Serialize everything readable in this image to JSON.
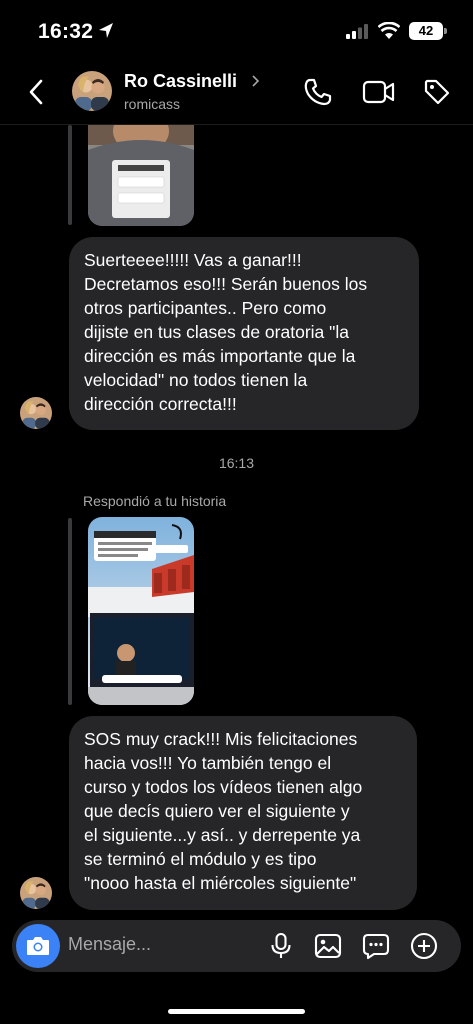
{
  "status_bar": {
    "time": "16:32",
    "battery": "42"
  },
  "header": {
    "name": "Ro Cassinelli",
    "username": "romicass"
  },
  "messages": {
    "msg1": "Suerteeee!!!!! Vas a ganar!!!\nDecretamos eso!!! Serán buenos los\notros participantes.. Pero como\ndijiste en tus clases de oratoria \"la\ndirección es más importante que la\nvelocidad\"  no todos tienen la\ndirección correcta!!!",
    "timestamp": "16:13",
    "reply_label": "Respondió a tu historia",
    "msg2": "SOS muy crack!!! Mis felicitaciones\nhacia vos!!! Yo también tengo el\ncurso y todos los vídeos tienen algo\nque decís quiero ver el siguiente y\nel siguiente...y así.. y derrepente ya\nse terminó el módulo y es tipo\n\"nooo hasta el miércoles siguiente\""
  },
  "composer": {
    "placeholder": "Mensaje..."
  },
  "colors": {
    "bubble": "#262628",
    "camera": "#3b82f6",
    "background": "#000000"
  },
  "icons": [
    "back-icon",
    "phone-icon",
    "video-call-icon",
    "tag-icon",
    "camera-icon",
    "microphone-icon",
    "image-icon",
    "sticker-icon",
    "plus-icon"
  ]
}
